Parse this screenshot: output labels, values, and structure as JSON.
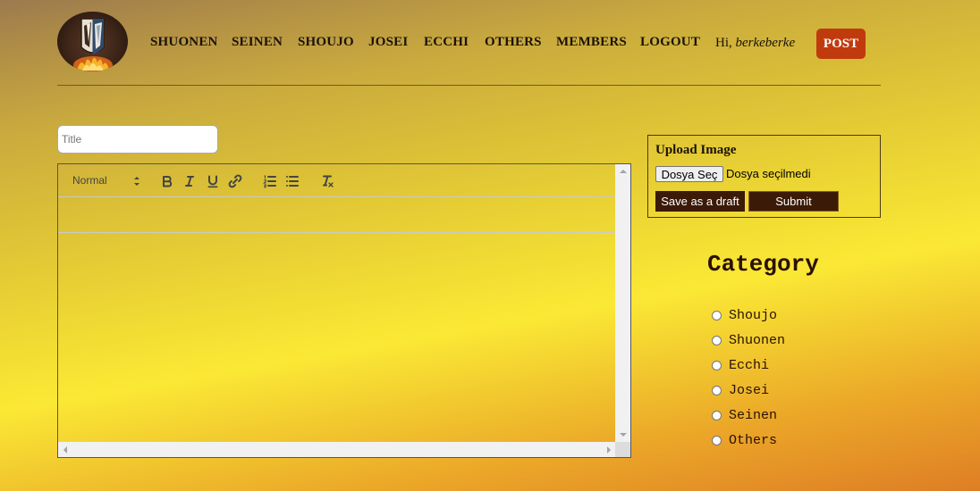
{
  "header": {
    "logo_icon": "survey-corps-emblem-icon",
    "nav": [
      {
        "label": "SHUONEN"
      },
      {
        "label": "SEINEN"
      },
      {
        "label": "SHOUJO"
      },
      {
        "label": "JOSEI"
      },
      {
        "label": "ECCHI"
      },
      {
        "label": "OTHERS"
      },
      {
        "label": "MEMBERS"
      },
      {
        "label": "LOGOUT"
      }
    ],
    "greeting_prefix": "Hi, ",
    "username": "berkeberke",
    "post_label": "POST",
    "post_color": "#c13a0e"
  },
  "editor": {
    "title_placeholder": "Title",
    "header_select_value": "Normal",
    "toolbar_icons": [
      "bold-icon",
      "italic-icon",
      "underline-icon",
      "link-icon",
      "ordered-list-icon",
      "bullet-list-icon",
      "clear-format-icon"
    ]
  },
  "upload": {
    "title": "Upload Image",
    "choose_file_label": "Dosya Seç",
    "no_file_text": "Dosya seçilmedi",
    "draft_label": "Save as a draft",
    "submit_label": "Submit",
    "button_color": "#3b1a08"
  },
  "category": {
    "title": "Category",
    "options": [
      {
        "label": "Shoujo"
      },
      {
        "label": "Shuonen"
      },
      {
        "label": "Ecchi"
      },
      {
        "label": "Josei"
      },
      {
        "label": "Seinen"
      },
      {
        "label": "Others"
      }
    ]
  }
}
